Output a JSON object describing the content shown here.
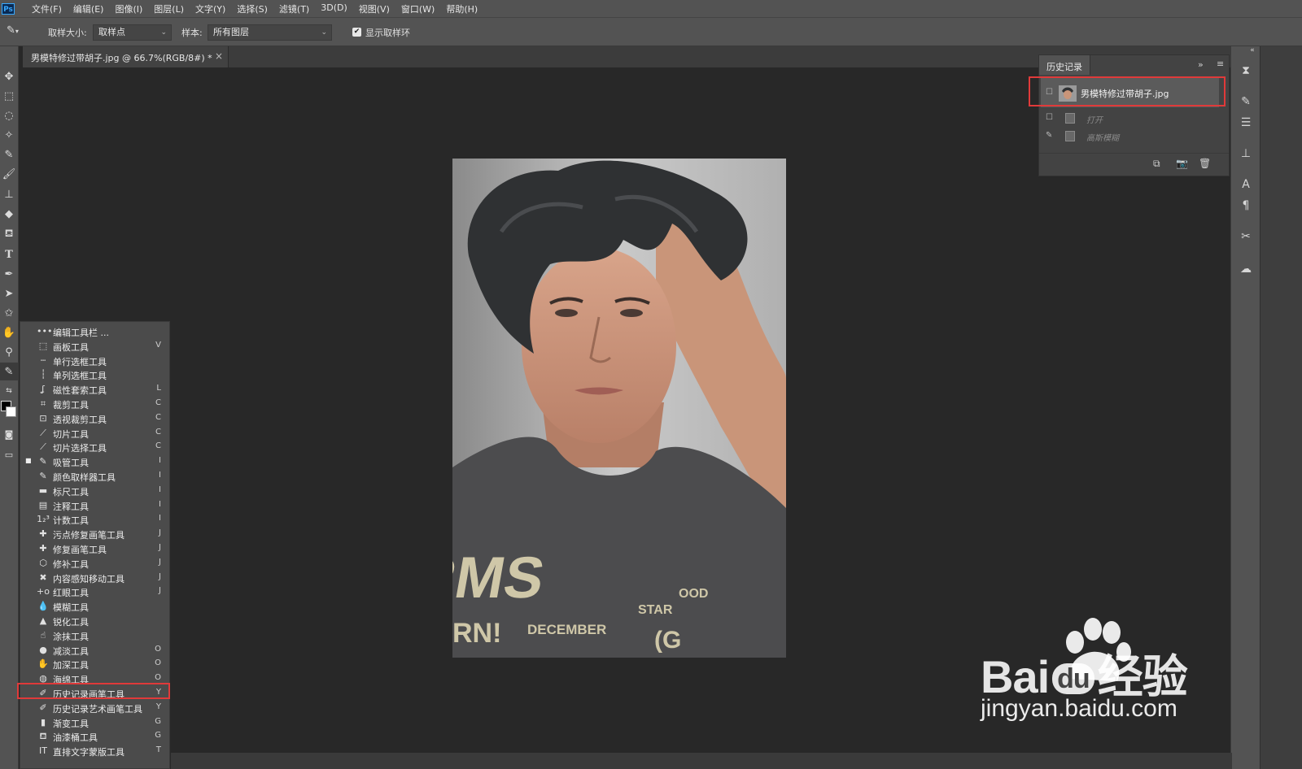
{
  "app_logo": "Ps",
  "menu": [
    "文件(F)",
    "编辑(E)",
    "图像(I)",
    "图层(L)",
    "文字(Y)",
    "选择(S)",
    "滤镜(T)",
    "3D(D)",
    "视图(V)",
    "窗口(W)",
    "帮助(H)"
  ],
  "options": {
    "sample_size_label": "取样大小:",
    "sample_size_value": "取样点",
    "sample_label": "样本:",
    "sample_value": "所有图层",
    "show_ring_label": "显示取样环",
    "show_ring_checked": true
  },
  "document_tab": {
    "title": "男模特修过带胡子.jpg @ 66.7%(RGB/8#) *",
    "close": "×"
  },
  "flyout": [
    {
      "icon": "more-icon",
      "glyph": "•••",
      "label": "编辑工具栏 ...",
      "key": ""
    },
    {
      "icon": "artboard-icon",
      "glyph": "⬚",
      "label": "画板工具",
      "key": "V"
    },
    {
      "icon": "single-row-icon",
      "glyph": "┄",
      "label": "单行选框工具",
      "key": ""
    },
    {
      "icon": "single-column-icon",
      "glyph": "┆",
      "label": "单列选框工具",
      "key": ""
    },
    {
      "icon": "magnetic-lasso-icon",
      "glyph": "ʆ",
      "label": "磁性套索工具",
      "key": "L"
    },
    {
      "icon": "crop-icon",
      "glyph": "⌗",
      "label": "裁剪工具",
      "key": "C"
    },
    {
      "icon": "perspective-crop-icon",
      "glyph": "⊡",
      "label": "透视裁剪工具",
      "key": "C"
    },
    {
      "icon": "slice-icon",
      "glyph": "⟋",
      "label": "切片工具",
      "key": "C"
    },
    {
      "icon": "slice-select-icon",
      "glyph": "⟋",
      "label": "切片选择工具",
      "key": "C"
    },
    {
      "icon": "eyedropper-icon",
      "glyph": "✎",
      "label": "吸管工具",
      "key": "I"
    },
    {
      "icon": "color-sampler-icon",
      "glyph": "✎",
      "label": "颜色取样器工具",
      "key": "I"
    },
    {
      "icon": "ruler-icon",
      "glyph": "▬",
      "label": "标尺工具",
      "key": "I"
    },
    {
      "icon": "note-icon",
      "glyph": "▤",
      "label": "注释工具",
      "key": "I"
    },
    {
      "icon": "count-icon",
      "glyph": "1₂³",
      "label": "计数工具",
      "key": "I"
    },
    {
      "icon": "spot-healing-icon",
      "glyph": "✚",
      "label": "污点修复画笔工具",
      "key": "J"
    },
    {
      "icon": "healing-brush-icon",
      "glyph": "✚",
      "label": "修复画笔工具",
      "key": "J"
    },
    {
      "icon": "patch-icon",
      "glyph": "⬡",
      "label": "修补工具",
      "key": "J"
    },
    {
      "icon": "content-aware-move-icon",
      "glyph": "✖",
      "label": "内容感知移动工具",
      "key": "J"
    },
    {
      "icon": "red-eye-icon",
      "glyph": "+o",
      "label": "红眼工具",
      "key": "J"
    },
    {
      "icon": "blur-icon",
      "glyph": "💧",
      "label": "模糊工具",
      "key": ""
    },
    {
      "icon": "sharpen-icon",
      "glyph": "▲",
      "label": "锐化工具",
      "key": ""
    },
    {
      "icon": "smudge-icon",
      "glyph": "☝",
      "label": "涂抹工具",
      "key": ""
    },
    {
      "icon": "dodge-icon",
      "glyph": "●",
      "label": "减淡工具",
      "key": "O"
    },
    {
      "icon": "burn-icon",
      "glyph": "✋",
      "label": "加深工具",
      "key": "O"
    },
    {
      "icon": "sponge-icon",
      "glyph": "◍",
      "label": "海绵工具",
      "key": "O"
    },
    {
      "icon": "history-brush-icon",
      "glyph": "✐",
      "label": "历史记录画笔工具",
      "key": "Y"
    },
    {
      "icon": "art-history-brush-icon",
      "glyph": "✐",
      "label": "历史记录艺术画笔工具",
      "key": "Y"
    },
    {
      "icon": "gradient-icon",
      "glyph": "▮",
      "label": "渐变工具",
      "key": "G"
    },
    {
      "icon": "paint-bucket-icon",
      "glyph": "⛾",
      "label": "油漆桶工具",
      "key": "G"
    },
    {
      "icon": "vertical-type-mask-icon",
      "glyph": "IT",
      "label": "直排文字蒙版工具",
      "key": "T"
    }
  ],
  "history_panel": {
    "tab_label": "历史记录",
    "snapshot_label": "男模特修过带胡子.jpg",
    "steps": [
      {
        "label": "打开",
        "is_source": false
      },
      {
        "label": "高斯模糊",
        "is_source": true
      }
    ]
  },
  "photo_tshirt_text": {
    "big": "ERMS",
    "line1": "RN!",
    "line2": "DECEMBER",
    "line3": "STAR",
    "line4": "OOD",
    "line5": "(G"
  },
  "watermark": {
    "brand_left": "Bai",
    "brand_mid": "du",
    "brand_right": "经验",
    "url": "jingyan.baidu.com"
  },
  "colors": {
    "highlight_red": "#e03a3a",
    "ui_panel": "#535353",
    "canvas_bg": "#282828",
    "fg_swatch": "#000000",
    "bg_swatch": "#ffffff"
  }
}
